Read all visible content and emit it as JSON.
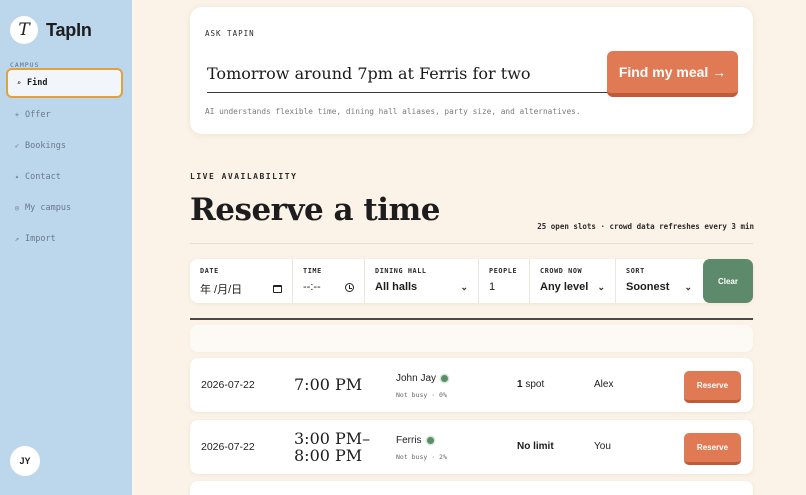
{
  "sidebar": {
    "brand_mark": "T",
    "brand_name": "TapIn",
    "section_label": "CAMPUS",
    "items": [
      {
        "icon": "⌕",
        "label": "Find"
      },
      {
        "icon": "+",
        "label": "Offer"
      },
      {
        "icon": "✓",
        "label": "Bookings"
      },
      {
        "icon": "✦",
        "label": "Contact"
      },
      {
        "icon": "◎",
        "label": "My campus"
      },
      {
        "icon": "↗",
        "label": "Import"
      }
    ],
    "avatar_initials": "JY"
  },
  "ask": {
    "label": "ASK TAPIN",
    "input_value": "Tomorrow around 7pm at Ferris for two",
    "button_label": "Find my meal →",
    "help_text": "AI understands flexible time, dining hall aliases, party size, and alternatives."
  },
  "availability": {
    "eyebrow": "LIVE AVAILABILITY",
    "title": "Reserve a time",
    "meta": "25 open slots · crowd data refreshes every 3 min"
  },
  "filters": {
    "date": {
      "label": "DATE",
      "value": "年 /月/日"
    },
    "time": {
      "label": "TIME",
      "value": "--:--"
    },
    "hall": {
      "label": "DINING HALL",
      "value": "All halls"
    },
    "people": {
      "label": "PEOPLE",
      "value": "1"
    },
    "crowd": {
      "label": "CROWD NOW",
      "value": "Any level"
    },
    "sort": {
      "label": "SORT",
      "value": "Soonest"
    },
    "clear_label": "Clear"
  },
  "rows": [
    {
      "date": "2026-07-22",
      "time": "7:00 PM",
      "hall": "John Jay",
      "crowd": "Not busy · 0%",
      "spots_number": "1",
      "spots_unit": "spot",
      "host": "Alex",
      "action": "Reserve"
    },
    {
      "date": "2026-07-22",
      "time_line1": "3:00 PM–",
      "time_line2": "8:00 PM",
      "hall": "Ferris",
      "crowd": "Not busy · 2%",
      "spots_number": "No limit",
      "spots_unit": "",
      "host": "You",
      "action": "Reserve"
    }
  ],
  "colors": {
    "accent_orange": "#e07a55",
    "clear_green": "#5c8a6a",
    "sidebar_blue": "#bcd6ec",
    "active_outline": "#e0a23e",
    "status_dot": "#5a8e66"
  }
}
